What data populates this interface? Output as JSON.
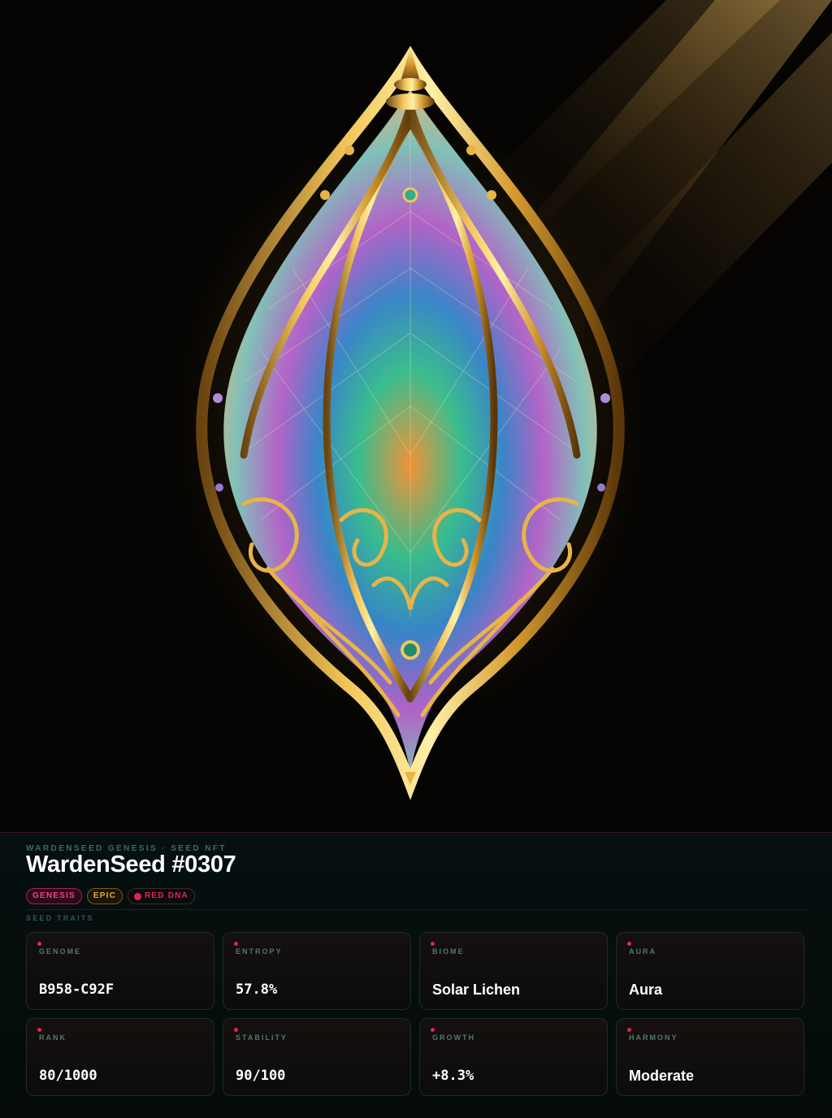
{
  "header": {
    "eyebrow": "WARDENSEED GENESIS · SEED NFT",
    "title": "WardenSeed #0307"
  },
  "badges": {
    "genesis": "GENESIS",
    "epic": "EPIC",
    "dna": "RED DNA"
  },
  "traits": {
    "section_label": "SEED TRAITS",
    "items": [
      {
        "label": "GENOME",
        "value": "B958-C92F"
      },
      {
        "label": "ENTROPY",
        "value": "57.8%"
      },
      {
        "label": "BIOME",
        "value": "Solar Lichen"
      },
      {
        "label": "AURA",
        "value": "Aura"
      },
      {
        "label": "RANK",
        "value": "80/1000"
      },
      {
        "label": "STABILITY",
        "value": "90/100"
      },
      {
        "label": "GROWTH",
        "value": "+8.3%"
      },
      {
        "label": "HARMONY",
        "value": "Moderate"
      }
    ]
  },
  "colors": {
    "accent_pink": "#ff3f8e",
    "accent_gold": "#e2b13c",
    "dna_red": "#e0245e",
    "label_green": "#4d7a6c",
    "panel_bg": "#061010"
  }
}
